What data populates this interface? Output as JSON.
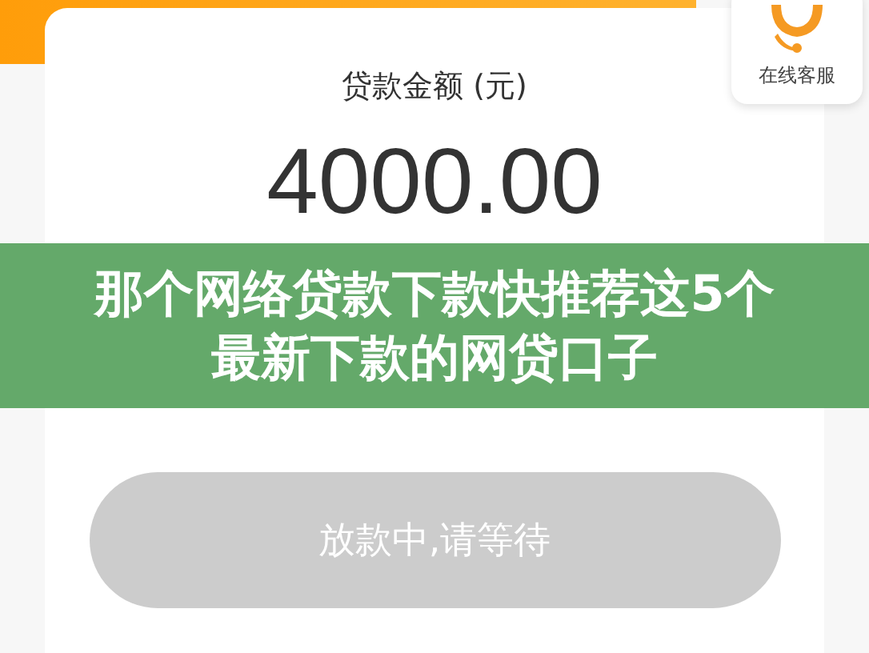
{
  "support": {
    "label": "在线客服"
  },
  "loan": {
    "label": "贷款金额 (元)",
    "amount": "4000.00"
  },
  "banner": {
    "title": "那个网络贷款下款快推荐这5个最新下款的网贷口子"
  },
  "submit_button": {
    "label": "放款中,请等待",
    "disabled": true
  }
}
